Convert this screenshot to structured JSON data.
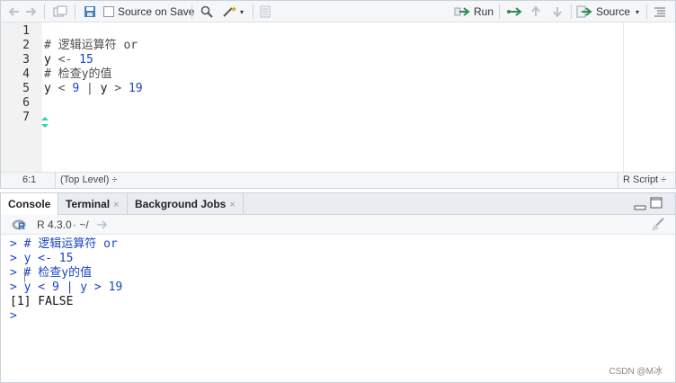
{
  "editor": {
    "toolbar": {
      "source_on_save_label": "Source on Save",
      "run_label": "Run",
      "source_label": "Source"
    },
    "line_numbers": [
      "1",
      "2",
      "3",
      "4",
      "5",
      "6",
      "7"
    ],
    "lines": [
      {
        "tokens": []
      },
      {
        "tokens": [
          {
            "text": "# 逻辑运算符 or",
            "cls": "cm"
          }
        ]
      },
      {
        "tokens": [
          {
            "text": "y ",
            "cls": "kw"
          },
          {
            "text": "<- ",
            "cls": "op"
          },
          {
            "text": "15",
            "cls": "num"
          }
        ]
      },
      {
        "tokens": [
          {
            "text": "# 检查y的值",
            "cls": "cm"
          }
        ]
      },
      {
        "tokens": [
          {
            "text": "y ",
            "cls": "kw"
          },
          {
            "text": "< ",
            "cls": "op"
          },
          {
            "text": "9",
            "cls": "num"
          },
          {
            "text": " | ",
            "cls": "op"
          },
          {
            "text": "y ",
            "cls": "kw"
          },
          {
            "text": "> ",
            "cls": "op"
          },
          {
            "text": "19",
            "cls": "num"
          }
        ]
      },
      {
        "tokens": []
      },
      {
        "tokens": []
      }
    ],
    "status": {
      "position": "6:1",
      "scope": "(Top Level) ÷",
      "filetype": "R Script ÷"
    }
  },
  "console": {
    "tabs": [
      {
        "label": "Console",
        "closable": false
      },
      {
        "label": "Terminal",
        "closable": true
      },
      {
        "label": "Background Jobs",
        "closable": true
      }
    ],
    "r_version": "R 4.3.0",
    "working_dir": "· ~/",
    "lines": [
      {
        "prompt": ">",
        "text": " # 逻辑运算符 or",
        "kind": "cin"
      },
      {
        "prompt": ">",
        "text": " y <- 15",
        "kind": "cin"
      },
      {
        "prompt": ">",
        "text": " # 检查y的值",
        "kind": "cin"
      },
      {
        "prompt": ">",
        "text": " y < 9 | y > 19",
        "kind": "cin"
      },
      {
        "prompt": "",
        "text": "[1] FALSE",
        "kind": "cout"
      },
      {
        "prompt": ">",
        "text": " ",
        "kind": "cin"
      }
    ],
    "watermark": "CSDN @M冰"
  },
  "colors": {
    "accent_blue": "#1a44c7",
    "run_green": "#2e8b57",
    "save_blue": "#4a7fb5"
  }
}
